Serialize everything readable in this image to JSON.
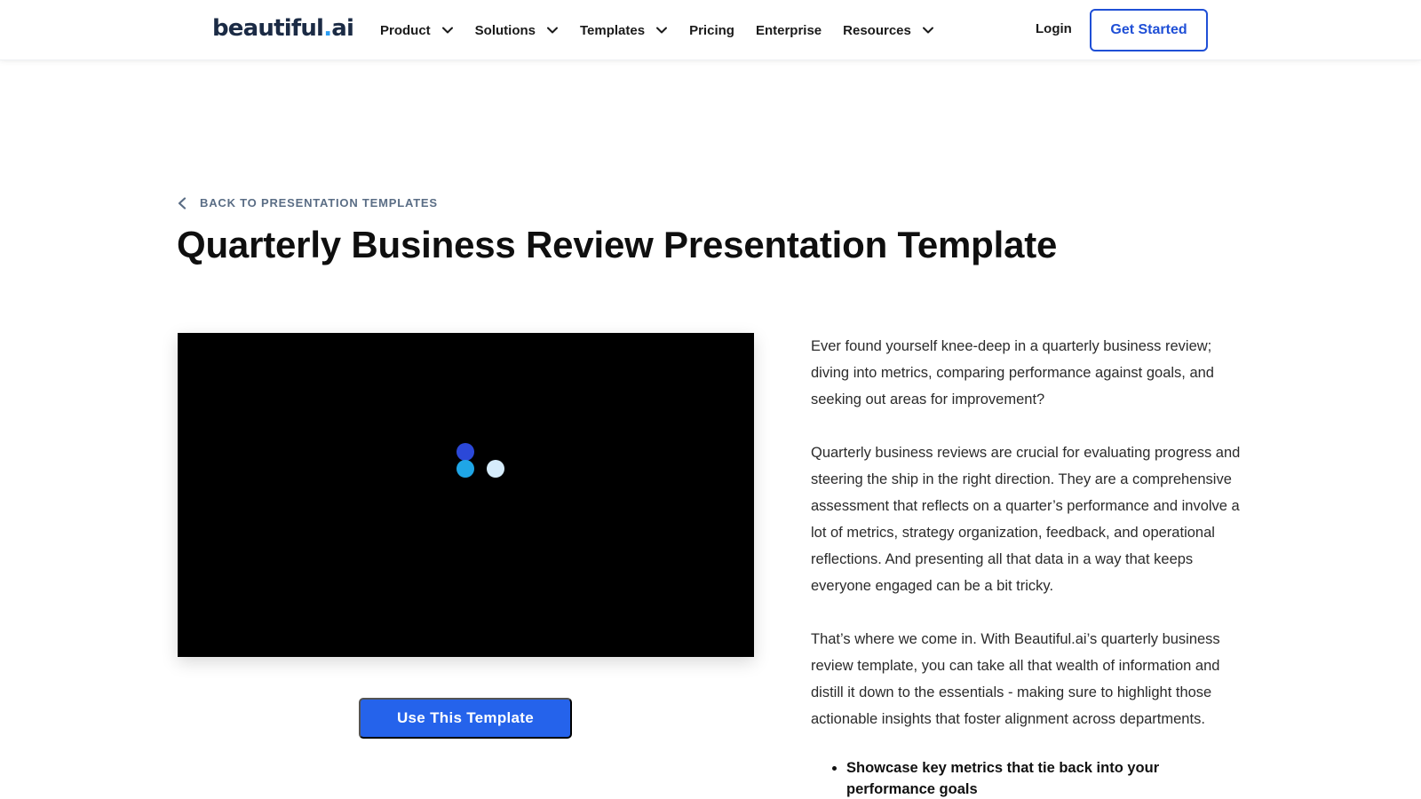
{
  "header": {
    "logo_main": "beautiful",
    "logo_dot": ".",
    "logo_tail": "ai",
    "nav": [
      {
        "label": "Product",
        "has_dropdown": true
      },
      {
        "label": "Solutions",
        "has_dropdown": true
      },
      {
        "label": "Templates",
        "has_dropdown": true
      },
      {
        "label": "Pricing",
        "has_dropdown": false
      },
      {
        "label": "Enterprise",
        "has_dropdown": false
      },
      {
        "label": "Resources",
        "has_dropdown": true
      }
    ],
    "login_label": "Login",
    "get_started_label": "Get Started"
  },
  "breadcrumb": {
    "back_label": "BACK TO PRESENTATION TEMPLATES"
  },
  "page": {
    "title": "Quarterly Business Review Presentation Template"
  },
  "preview": {
    "state": "loading",
    "use_template_label": "Use This Template"
  },
  "description": {
    "paragraphs": [
      "Ever found yourself knee-deep in a quarterly business review; diving into metrics, comparing performance against goals, and seeking out areas for improvement?",
      "Quarterly business reviews are crucial for evaluating progress and steering the ship in the right direction. They are a comprehensive assessment that reflects on a quarter’s performance and involve a lot of metrics, strategy organization, feedback, and operational reflections. And presenting all that data in a way that keeps everyone engaged can be a bit tricky.",
      "That’s where we come in. With Beautiful.ai’s quarterly business review template, you can take all that wealth of information and distill it down to the essentials - making sure to highlight those actionable insights that foster alignment across departments."
    ],
    "bullets": [
      "Showcase key metrics that tie back into your performance goals"
    ]
  },
  "colors": {
    "brand_blue": "#1f4fd6",
    "button_blue": "#2563eb",
    "logo_navy": "#1b2b45",
    "loader_dot_1": "#2b48d8",
    "loader_dot_2": "#1fa6e6",
    "loader_dot_3": "#d6ecfb"
  }
}
